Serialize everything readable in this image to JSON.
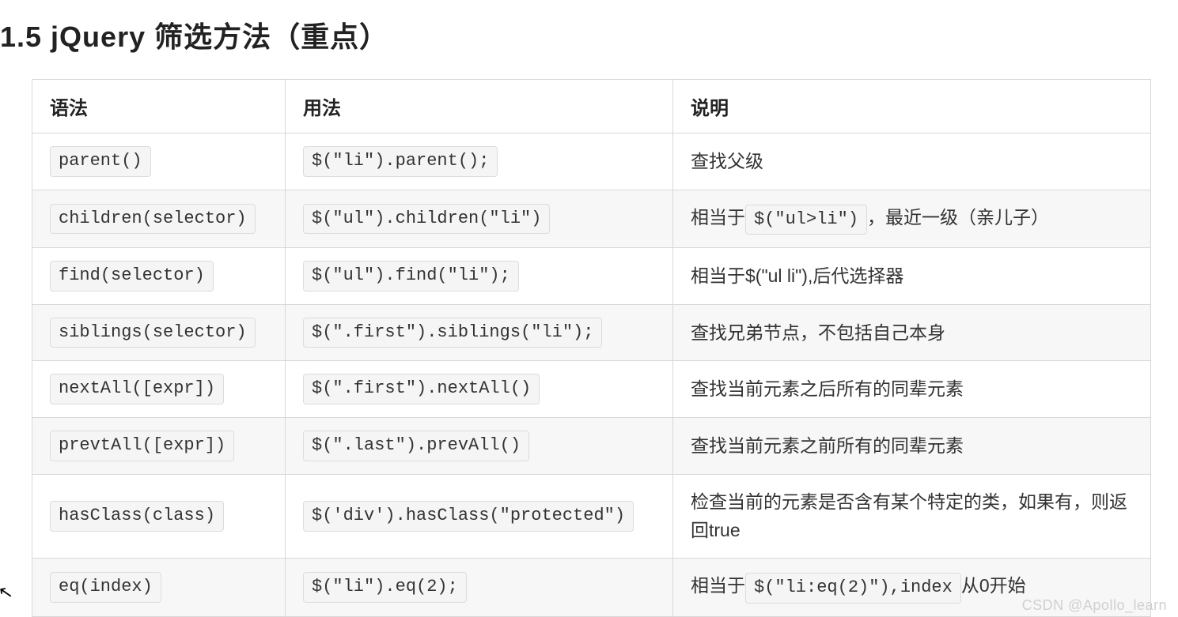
{
  "heading": "1.5  jQuery 筛选方法（重点）",
  "columns": {
    "syntax": "语法",
    "usage": "用法",
    "desc": "说明"
  },
  "rows": [
    {
      "syntax": "parent()",
      "usage": "$(\"li\").parent();",
      "desc_parts": [
        {
          "type": "text",
          "value": "查找父级"
        }
      ]
    },
    {
      "syntax": "children(selector)",
      "usage": "$(\"ul\").children(\"li\")",
      "desc_parts": [
        {
          "type": "text",
          "value": "相当于"
        },
        {
          "type": "code",
          "value": "$(\"ul>li\")"
        },
        {
          "type": "text",
          "value": "，最近一级（亲儿子）"
        }
      ]
    },
    {
      "syntax": "find(selector)",
      "usage": "$(\"ul\").find(\"li\");",
      "desc_parts": [
        {
          "type": "text",
          "value": "相当于$(\"ul li\"),后代选择器"
        }
      ]
    },
    {
      "syntax": "siblings(selector)",
      "usage": "$(\".first\").siblings(\"li\");",
      "desc_parts": [
        {
          "type": "text",
          "value": "查找兄弟节点，不包括自己本身"
        }
      ]
    },
    {
      "syntax": "nextAll([expr])",
      "usage": "$(\".first\").nextAll()",
      "desc_parts": [
        {
          "type": "text",
          "value": "查找当前元素之后所有的同辈元素"
        }
      ]
    },
    {
      "syntax": "prevtAll([expr])",
      "usage": "$(\".last\").prevAll()",
      "desc_parts": [
        {
          "type": "text",
          "value": "查找当前元素之前所有的同辈元素"
        }
      ]
    },
    {
      "syntax": "hasClass(class)",
      "usage": "$('div').hasClass(\"protected\")",
      "desc_parts": [
        {
          "type": "text",
          "value": "检查当前的元素是否含有某个特定的类，如果有，则返回true"
        }
      ]
    },
    {
      "syntax": "eq(index)",
      "usage": "$(\"li\").eq(2);",
      "desc_parts": [
        {
          "type": "text",
          "value": "相当于"
        },
        {
          "type": "code",
          "value": "$(\"li:eq(2)\"),index"
        },
        {
          "type": "text",
          "value": "从0开始"
        }
      ]
    }
  ],
  "watermark": "CSDN @Apollo_learn"
}
